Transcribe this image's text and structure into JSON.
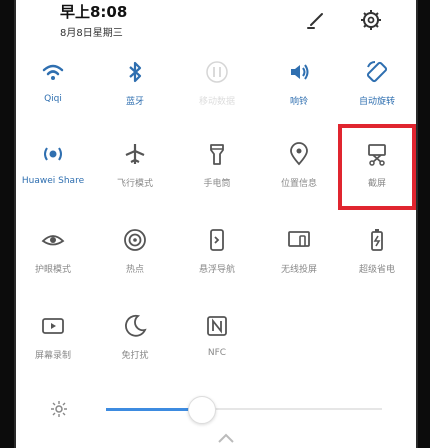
{
  "status": {
    "time": "早上8:08",
    "date": "8月8日星期三"
  },
  "header": {
    "edit_icon": "pencil-icon",
    "settings_icon": "gear-icon"
  },
  "tiles": [
    {
      "label": "Qiqi",
      "icon": "wifi-icon",
      "on": true
    },
    {
      "label": "蓝牙",
      "icon": "bluetooth-icon",
      "on": true
    },
    {
      "label": "移动数据",
      "icon": "mobile-data-icon",
      "on": false
    },
    {
      "label": "响铃",
      "icon": "volume-icon",
      "on": true
    },
    {
      "label": "自动旋转",
      "icon": "rotate-icon",
      "on": true
    },
    {
      "label": "Huawei Share",
      "icon": "huawei-share-icon",
      "on": true
    },
    {
      "label": "飞行模式",
      "icon": "airplane-icon",
      "on": false
    },
    {
      "label": "手电筒",
      "icon": "flashlight-icon",
      "on": false
    },
    {
      "label": "位置信息",
      "icon": "location-icon",
      "on": false
    },
    {
      "label": "截屏",
      "icon": "screenshot-icon",
      "on": false
    },
    {
      "label": "护眼模式",
      "icon": "eye-icon",
      "on": false
    },
    {
      "label": "热点",
      "icon": "hotspot-icon",
      "on": false
    },
    {
      "label": "悬浮导航",
      "icon": "floating-nav-icon",
      "on": false
    },
    {
      "label": "无线投屏",
      "icon": "cast-icon",
      "on": false
    },
    {
      "label": "超级省电",
      "icon": "battery-saver-icon",
      "on": false
    },
    {
      "label": "屏幕录制",
      "icon": "screen-record-icon",
      "on": false
    },
    {
      "label": "免打扰",
      "icon": "moon-icon",
      "on": false
    },
    {
      "label": "NFC",
      "icon": "nfc-icon",
      "on": false
    }
  ],
  "brightness": {
    "level": 0.3,
    "icon": "sun-icon"
  },
  "colors": {
    "active": "#2f6fb0",
    "inactive": "#888888",
    "highlight": "#e0252f"
  }
}
